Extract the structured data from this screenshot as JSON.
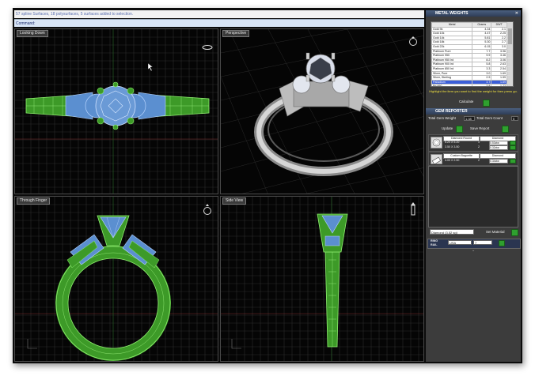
{
  "command_bar": {
    "info": "57 spline Surfaces, 18 polysurfaces, 5 surfaces added to selection.",
    "prompt": "Command:"
  },
  "viewports": [
    {
      "label": "Looking Down"
    },
    {
      "label": "Perspective"
    },
    {
      "label": "Through Finger"
    },
    {
      "label": "Side View"
    }
  ],
  "metal_weights": {
    "title": "METAL WEIGHTS",
    "columns": [
      "Metal",
      "Grams",
      "DWT"
    ],
    "rows": [
      [
        "Gold 9k",
        "4.34",
        "2.1"
      ],
      [
        "Gold 10k",
        "4.47",
        "2.25"
      ],
      [
        "Gold 14k",
        "5.81",
        "2.2"
      ],
      [
        "Gold 18k",
        "5.30",
        "2.7"
      ],
      [
        "Gold 22k",
        "6.15",
        "3.0"
      ],
      [
        "Platinum Pure",
        "7.7",
        "3.96"
      ],
      [
        "Platinum 950",
        "9.9",
        "3.46"
      ],
      [
        "Platinum 950 Ird",
        "8.2",
        "3.06"
      ],
      [
        "Platinum 900 Ird",
        "5.8",
        "2.63"
      ],
      [
        "Platinum 850 Ird",
        "3.3",
        "2.54"
      ],
      [
        "Silver, Pure",
        "3.0",
        "1.69"
      ],
      [
        "Silver, Sterling",
        "2.9",
        "1.59"
      ],
      [
        "Palladium",
        "3.7",
        "1.69"
      ],
      [
        "Pd 950",
        "3.8",
        "1.72"
      ]
    ],
    "highlight_row": 12,
    "hint": "Highlight the item you want to find the weight for then press go.",
    "calculate_label": "Calculate",
    "go_label": "go"
  },
  "gem_reporter": {
    "title": "GEM REPORTER",
    "total_weight_label": "Total Gem Weight",
    "total_weight_value": "1.08",
    "total_count_label": "Total Gem Count",
    "total_count_value": "5",
    "update_label": "Update",
    "save_label": "Save Report",
    "items": [
      {
        "shape": "Diamond Round",
        "type": "Diamond",
        "size1": "5.20 X 5.20",
        "qty1": "1",
        "ct1": "0.53ctw",
        "size2": "3.50 X 3.50",
        "qty2": "2",
        "ct2": "0.32ctw"
      },
      {
        "shape": "Custom Baguette",
        "type": "Diamond",
        "size1": "4.00 X 2.50",
        "qty1": "2",
        "ct1": "0.34ctw"
      }
    ],
    "material_value": "Diamond (3.52 sg)",
    "set_material_label": "Set Material"
  },
  "ring": {
    "title": "RING RAIL",
    "standard": "USA",
    "size": "7"
  }
}
